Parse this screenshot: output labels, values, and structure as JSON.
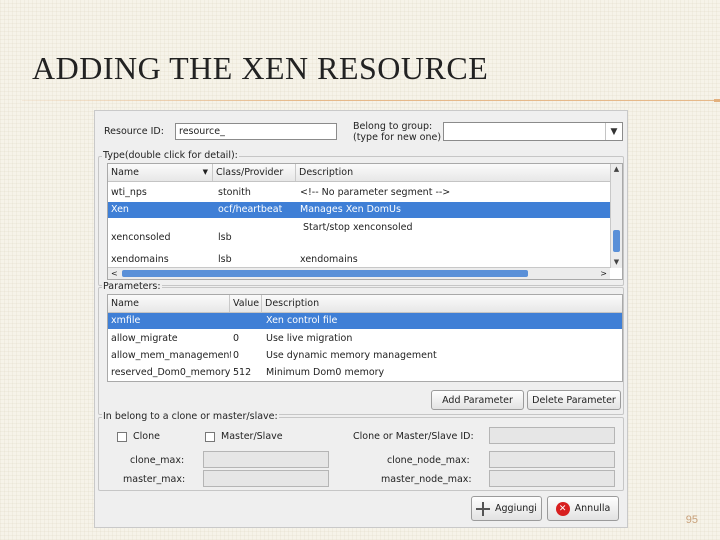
{
  "slide": {
    "title": "ADDING THE XEN RESOURCE",
    "page_number": "95"
  },
  "dialog": {
    "resource_id_label": "Resource ID:",
    "resource_id_value": "resource_",
    "belong_group_label_1": "Belong to group:",
    "belong_group_label_2": "(type for new one)",
    "belong_group_value": "",
    "type_section_label": "Type(double click for detail):",
    "type_table": {
      "headers": [
        "Name",
        "Class/Provider",
        "Description"
      ],
      "rows": [
        {
          "name": "wti_nps",
          "provider": "stonith",
          "description": "<!-- No parameter segment -->"
        },
        {
          "name": "Xen",
          "provider": "ocf/heartbeat",
          "description": "Manages Xen DomUs"
        },
        {
          "name": "xenconsoled",
          "provider": "lsb",
          "description": "Start/stop xenconsoled"
        },
        {
          "name": "xendomains",
          "provider": "lsb",
          "description": "xendomains"
        }
      ],
      "selected_index": 1,
      "scroll_left": "<",
      "scroll_right": ">"
    },
    "params_section_label": "Parameters:",
    "params_table": {
      "headers": [
        "Name",
        "Value",
        "Description"
      ],
      "rows": [
        {
          "name": "xmfile",
          "value": "",
          "description": "Xen control file"
        },
        {
          "name": "allow_migrate",
          "value": "0",
          "description": "Use live migration"
        },
        {
          "name": "allow_mem_management",
          "value": "0",
          "description": "Use dynamic memory management"
        },
        {
          "name": "reserved_Dom0_memory",
          "value": "512",
          "description": "Minimum Dom0 memory"
        }
      ],
      "selected_index": 0
    },
    "add_parameter_label": "Add Parameter",
    "delete_parameter_label": "Delete Parameter",
    "clone_section_label": "In belong to a clone or master/slave:",
    "clone_label": "Clone",
    "master_slave_label": "Master/Slave",
    "clone_ms_id_label": "Clone or Master/Slave ID:",
    "clone_max_label": "clone_max:",
    "clone_node_max_label": "clone_node_max:",
    "master_max_label": "master_max:",
    "master_node_max_label": "master_node_max:",
    "ok_label": "Aggiungi",
    "cancel_label": "Annulla"
  },
  "colors": {
    "selection": "#3f7fd6",
    "title_rule": "#e6b98a"
  }
}
